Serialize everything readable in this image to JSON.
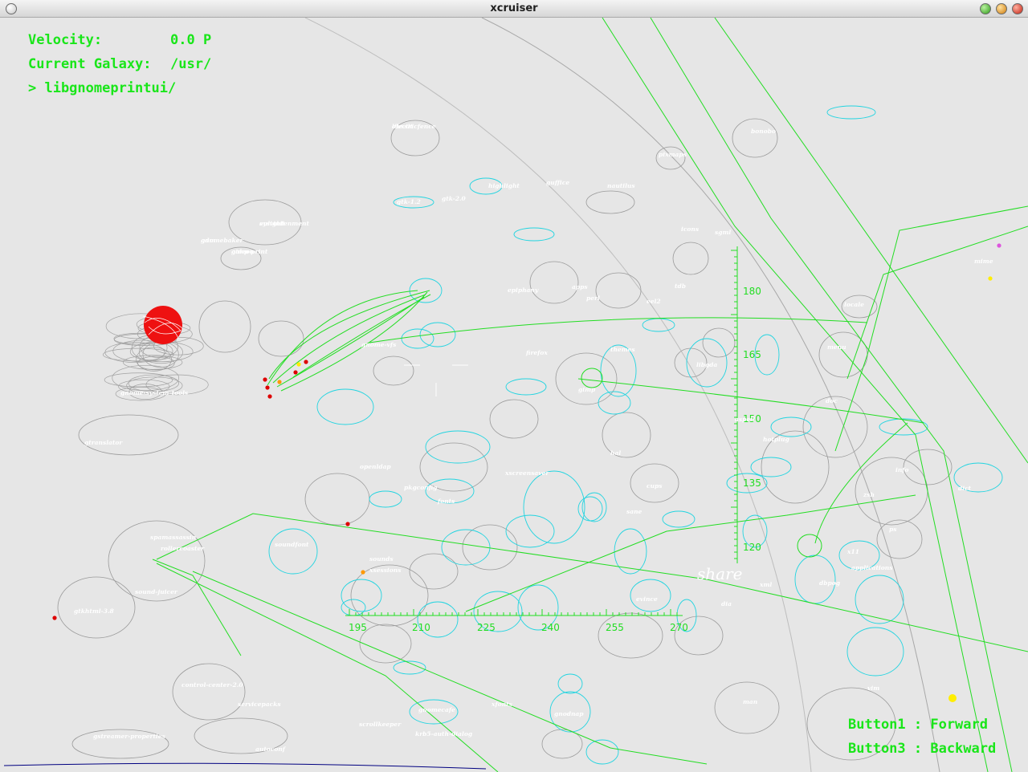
{
  "window": {
    "title": "xcruiser"
  },
  "hud": {
    "velocity_label": "Velocity:",
    "velocity_value": "0.0 P",
    "galaxy_label": "Current Galaxy:",
    "galaxy_value": "/usr/",
    "target": "> libgnomeprintui/",
    "button1": "Button1 : Forward",
    "button3": "Button3 : Backward"
  },
  "share_label": "share",
  "scale": {
    "horizontal_ticks": [
      "195",
      "210",
      "225",
      "240",
      "255",
      "270"
    ],
    "vertical_ticks": [
      "180",
      "165",
      "150",
      "135",
      "120"
    ]
  },
  "labels": [
    "electricfence",
    "enlightenment",
    "gnomebaker",
    "gimp-print",
    "gtk-2.0",
    "guffice",
    "nautilus",
    "pixmaps",
    "gtk-1.2",
    "highlight",
    "openldap",
    "pkgconfig",
    "gnome-system-tools",
    "gnome-vfs",
    "gtranslator",
    "sounds",
    "xsessions",
    "soundfont",
    "spamassassin",
    "rollercoaster",
    "sound-juicer",
    "gtkhtml-3.8",
    "control-center-2.0",
    "servicepacks",
    "gstreamer-properties",
    "autoconf",
    "scrollkeeper",
    "krb5-auth-dialog",
    "gnomecafe",
    "xfonts",
    "gnodnap",
    "apps",
    "epiphany",
    "themes",
    "cups",
    "firefox",
    "xscreensaver",
    "gimp",
    "fonts",
    "dict",
    "xml",
    "dbpog",
    "man",
    "vim",
    "locale",
    "eel2",
    "libgda",
    "x11",
    "ps",
    "applications",
    "sane",
    "evince",
    "hal",
    "dia",
    "doc",
    "info",
    "zsh",
    "aspell",
    "hotplug",
    "sgml",
    "tdb",
    "icons",
    "perl",
    "mime",
    "bonobo",
    "menu",
    "libxslt",
    "sysvinit",
    "gdm",
    "galeon"
  ]
}
